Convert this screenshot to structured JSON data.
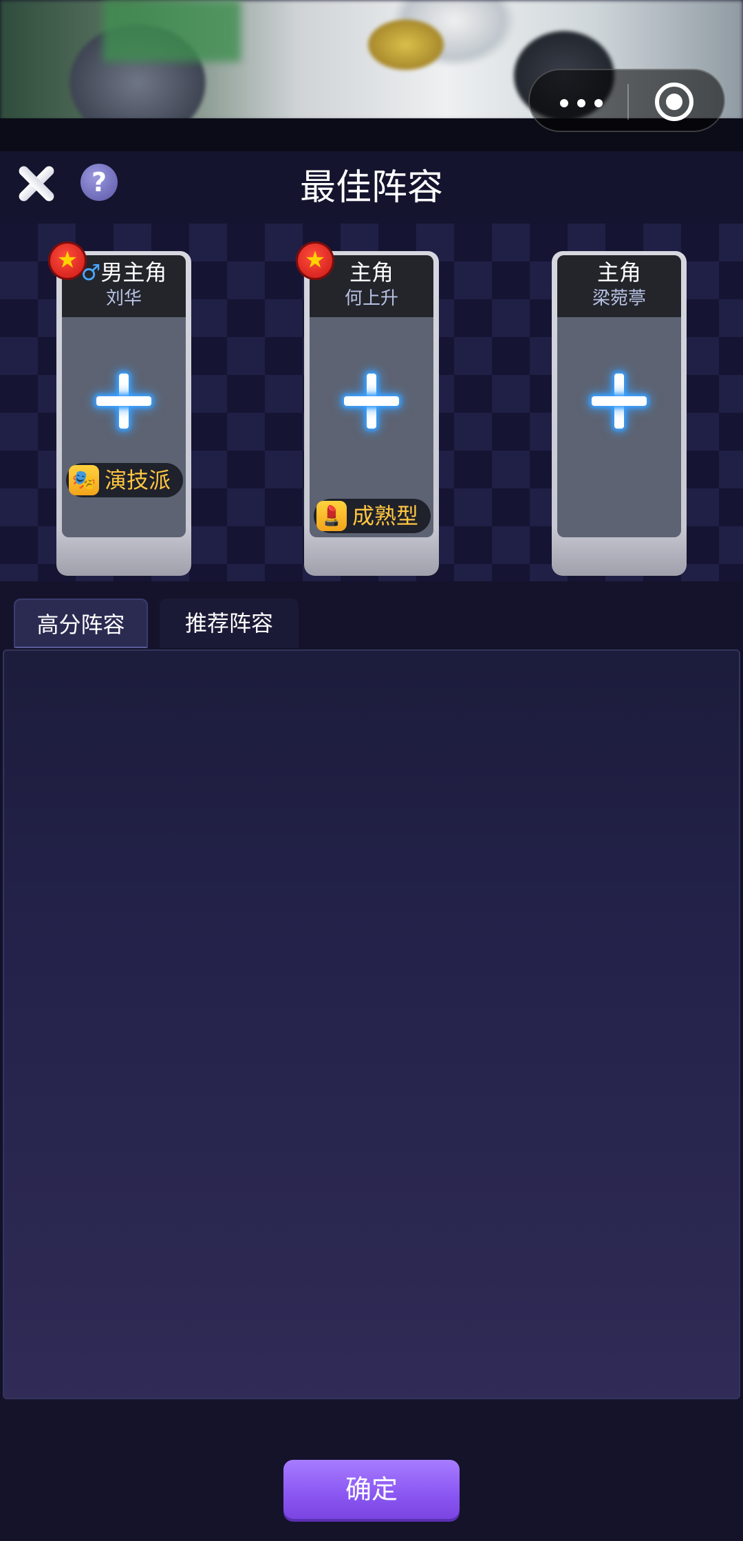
{
  "header": {
    "title": "最佳阵容",
    "help_label": "?"
  },
  "capsule": {
    "more_icon": "more-dots-icon",
    "close_icon": "target-circle-icon"
  },
  "cards": [
    {
      "role_gender": "♂",
      "role": "男主角",
      "name": "刘华",
      "has_badge": true,
      "trait": "演技派",
      "trait_icon": "🎭",
      "plus_icon": "plus-icon"
    },
    {
      "role_gender": "",
      "role": "主角",
      "name": "何上升",
      "has_badge": true,
      "trait": "成熟型",
      "trait_icon": "💄",
      "plus_icon": "plus-icon"
    },
    {
      "role_gender": "",
      "role": "主角",
      "name": "梁菀葶",
      "has_badge": false,
      "trait": "",
      "plus_icon": "plus-icon"
    }
  ],
  "tabs": [
    {
      "label": "高分阵容",
      "active": true
    },
    {
      "label": "推荐阵容",
      "active": false
    }
  ],
  "footer": {
    "confirm_label": "确定"
  },
  "colors": {
    "accent": "#8a56f2",
    "badge": "#d81e1e",
    "trait_text": "#ffc640",
    "plus_glow": "#3aa0ff"
  }
}
